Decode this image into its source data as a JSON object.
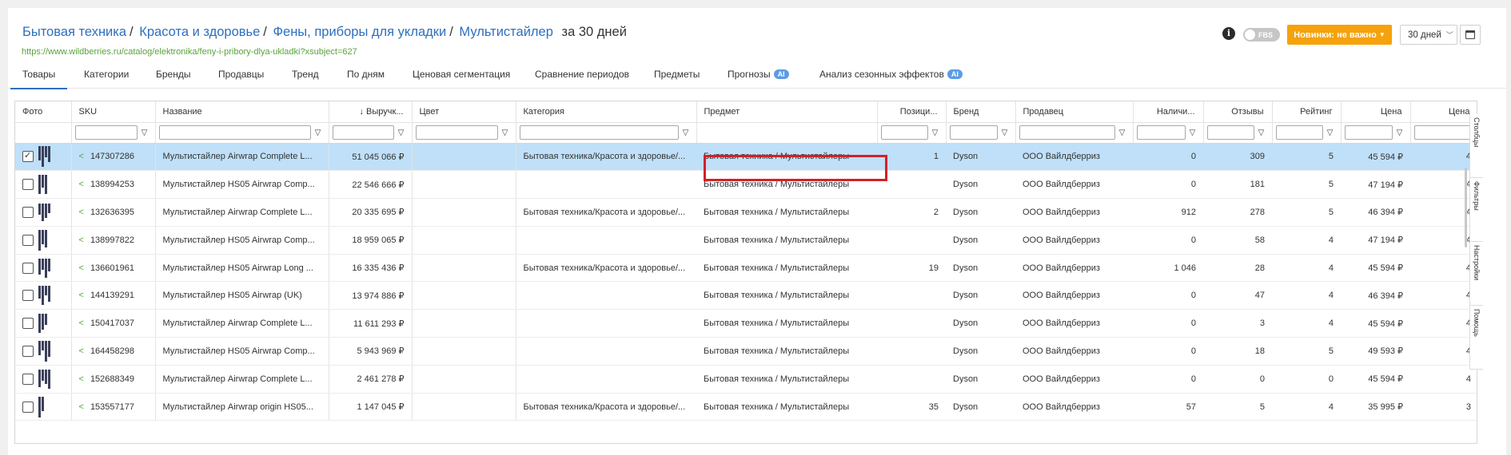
{
  "breadcrumbs": [
    "Бытовая техника",
    "Красота и здоровье",
    "Фены, приборы для укладки",
    "Мультистайлер"
  ],
  "period_label": "за 30 дней",
  "url": "https://www.wildberries.ru/catalog/elektronika/feny-i-pribory-dlya-ukladki?xsubject=627",
  "controls": {
    "fbs_label": "FBS",
    "novelty_button": "Новинки: не важно",
    "period_select": "30 дней"
  },
  "tabs": [
    {
      "label": "Товары",
      "ai": false
    },
    {
      "label": "Категории",
      "ai": false
    },
    {
      "label": "Бренды",
      "ai": false
    },
    {
      "label": "Продавцы",
      "ai": false
    },
    {
      "label": "Тренд",
      "ai": false
    },
    {
      "label": "По дням",
      "ai": false
    },
    {
      "label": "Ценовая сегментация",
      "ai": false
    },
    {
      "label": "Сравнение периодов",
      "ai": false
    },
    {
      "label": "Предметы",
      "ai": false
    },
    {
      "label": "Прогнозы",
      "ai": true
    },
    {
      "label": "Анализ сезонных эффектов",
      "ai": true
    }
  ],
  "ai_badge": "AI",
  "columns": [
    "Фото",
    "SKU",
    "Название",
    "↓ Выручк...",
    "Цвет",
    "Категория",
    "Предмет",
    "Позици...",
    "Бренд",
    "Продавец",
    "Наличи...",
    "Отзывы",
    "Рейтинг",
    "Цена",
    "Цена"
  ],
  "rows": [
    {
      "sku": "147307286",
      "name": "Мультистайлер Airwrap Complete L...",
      "revenue": "51 045 066 ₽",
      "color": "",
      "category": "Бытовая техника/Красота и здоровье/...",
      "subject": "Бытовая техника / Мультистайлеры",
      "position": "1",
      "brand": "Dyson",
      "seller": "ООО Вайлдберриз",
      "stock": "0",
      "reviews": "309",
      "rating": "5",
      "price": "45 594 ₽",
      "selected": true
    },
    {
      "sku": "138994253",
      "name": "Мультистайлер HS05 Airwrap Comp...",
      "revenue": "22 546 666 ₽",
      "color": "",
      "category": "",
      "subject": "Бытовая техника / Мультистайлеры",
      "position": "",
      "brand": "Dyson",
      "seller": "ООО Вайлдберриз",
      "stock": "0",
      "reviews": "181",
      "rating": "5",
      "price": "47 194 ₽",
      "selected": false
    },
    {
      "sku": "132636395",
      "name": "Мультистайлер Airwrap Complete L...",
      "revenue": "20 335 695 ₽",
      "color": "",
      "category": "Бытовая техника/Красота и здоровье/...",
      "subject": "Бытовая техника / Мультистайлеры",
      "position": "2",
      "brand": "Dyson",
      "seller": "ООО Вайлдберриз",
      "stock": "912",
      "reviews": "278",
      "rating": "5",
      "price": "46 394 ₽",
      "selected": false
    },
    {
      "sku": "138997822",
      "name": "Мультистайлер HS05 Airwrap Comp...",
      "revenue": "18 959 065 ₽",
      "color": "",
      "category": "",
      "subject": "Бытовая техника / Мультистайлеры",
      "position": "",
      "brand": "Dyson",
      "seller": "ООО Вайлдберриз",
      "stock": "0",
      "reviews": "58",
      "rating": "4",
      "price": "47 194 ₽",
      "selected": false
    },
    {
      "sku": "136601961",
      "name": "Мультистайлер HS05 Airwrap Long ...",
      "revenue": "16 335 436 ₽",
      "color": "",
      "category": "Бытовая техника/Красота и здоровье/...",
      "subject": "Бытовая техника / Мультистайлеры",
      "position": "19",
      "brand": "Dyson",
      "seller": "ООО Вайлдберриз",
      "stock": "1 046",
      "reviews": "28",
      "rating": "4",
      "price": "45 594 ₽",
      "selected": false
    },
    {
      "sku": "144139291",
      "name": "Мультистайлер HS05 Airwrap (UK)",
      "revenue": "13 974 886 ₽",
      "color": "",
      "category": "",
      "subject": "Бытовая техника / Мультистайлеры",
      "position": "",
      "brand": "Dyson",
      "seller": "ООО Вайлдберриз",
      "stock": "0",
      "reviews": "47",
      "rating": "4",
      "price": "46 394 ₽",
      "selected": false
    },
    {
      "sku": "150417037",
      "name": "Мультистайлер Airwrap Complete L...",
      "revenue": "11 611 293 ₽",
      "color": "",
      "category": "",
      "subject": "Бытовая техника / Мультистайлеры",
      "position": "",
      "brand": "Dyson",
      "seller": "ООО Вайлдберриз",
      "stock": "0",
      "reviews": "3",
      "rating": "4",
      "price": "45 594 ₽",
      "selected": false
    },
    {
      "sku": "164458298",
      "name": "Мультистайлер HS05 Airwrap Comp...",
      "revenue": "5 943 969 ₽",
      "color": "",
      "category": "",
      "subject": "Бытовая техника / Мультистайлеры",
      "position": "",
      "brand": "Dyson",
      "seller": "ООО Вайлдберриз",
      "stock": "0",
      "reviews": "18",
      "rating": "5",
      "price": "49 593 ₽",
      "selected": false
    },
    {
      "sku": "152688349",
      "name": "Мультистайлер Airwrap Complete L...",
      "revenue": "2 461 278 ₽",
      "color": "",
      "category": "",
      "subject": "Бытовая техника / Мультистайлеры",
      "position": "",
      "brand": "Dyson",
      "seller": "ООО Вайлдберриз",
      "stock": "0",
      "reviews": "0",
      "rating": "0",
      "price": "45 594 ₽",
      "selected": false
    },
    {
      "sku": "153557177",
      "name": "Мультистайлер Airwrap origin HS05...",
      "revenue": "1 147 045 ₽",
      "color": "",
      "category": "Бытовая техника/Красота и здоровье/...",
      "subject": "Бытовая техника / Мультистайлеры",
      "position": "35",
      "brand": "Dyson",
      "seller": "ООО Вайлдберриз",
      "stock": "57",
      "reviews": "5",
      "rating": "4",
      "price": "35 995 ₽",
      "selected": false
    }
  ],
  "last_price_partial": [
    "4",
    "4",
    "4",
    "4",
    "4",
    "4",
    "4",
    "4",
    "4",
    "3"
  ],
  "sidebar": [
    "Столбцы",
    "Фильтры",
    "Настройки",
    "Помощь"
  ],
  "colors": {
    "accent": "#2e6fbf",
    "orange": "#f5a20b",
    "selected_row": "#bfe0f8",
    "highlight_box": "#d42027",
    "url_green": "#5aa23c"
  }
}
